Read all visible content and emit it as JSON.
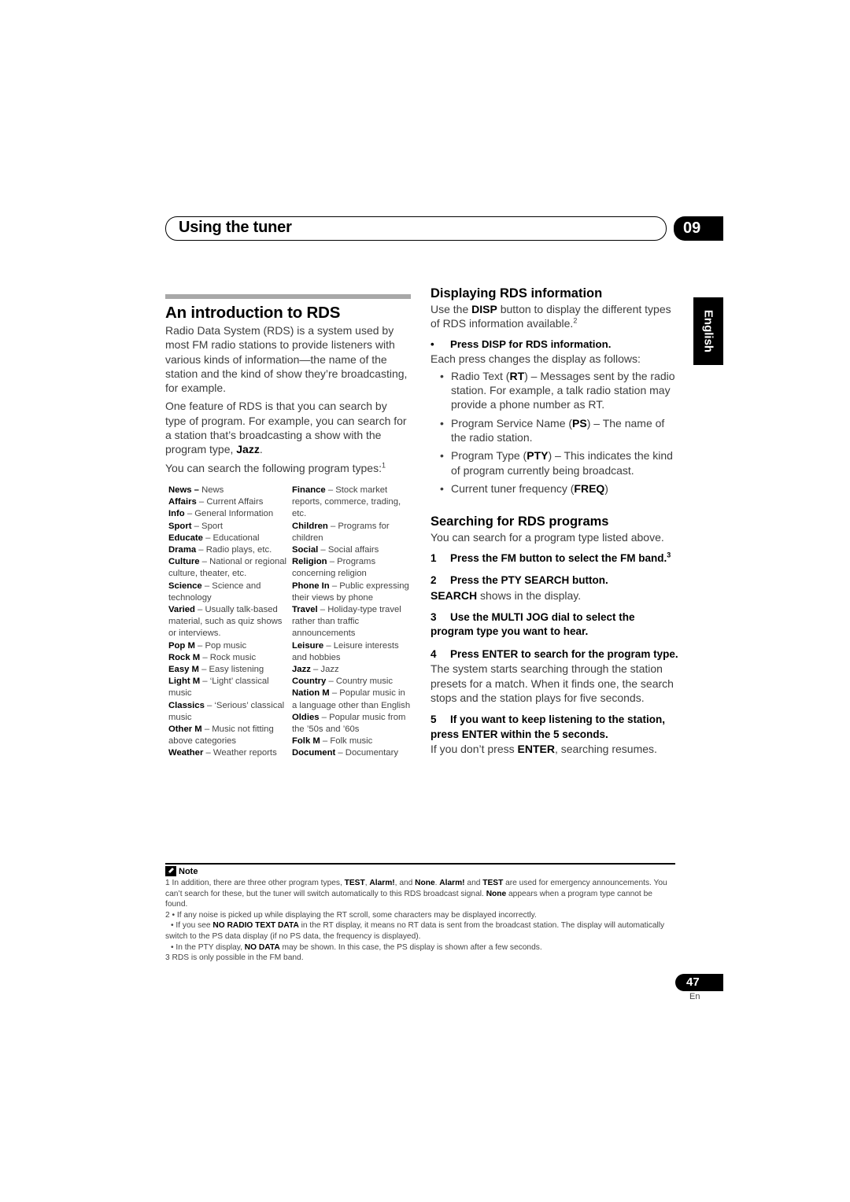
{
  "header": {
    "title": "Using the tuner",
    "chapter": "09"
  },
  "language_tab": "English",
  "intro": {
    "heading": "An introduction to RDS",
    "paragraphs": [
      "Radio Data System (RDS) is a system used by most FM radio stations to provide listeners with various kinds of information—the name of the station and the kind of show they’re broadcasting, for example.",
      "One feature of RDS is that you can search by type of program. For example, you can search for a station that’s broadcasting a show with the program type, "
    ],
    "jazz_bold": "Jazz",
    "period": ".",
    "search_line": "You can search the following program types:",
    "search_footnote": "1"
  },
  "program_types": {
    "left": [
      {
        "name": "News –",
        "desc": " News"
      },
      {
        "name": "Affairs",
        "desc": " – Current Affairs"
      },
      {
        "name": "Info",
        "desc": " – General Information"
      },
      {
        "name": "Sport",
        "desc": " – Sport"
      },
      {
        "name": "Educate",
        "desc": " – Educational"
      },
      {
        "name": "Drama",
        "desc": " – Radio plays, etc."
      },
      {
        "name": "Culture",
        "desc": " – National or regional culture, theater, etc."
      },
      {
        "name": "Science",
        "desc": " – Science and technology"
      },
      {
        "name": "Varied",
        "desc": " – Usually talk-based material, such as quiz shows or interviews."
      },
      {
        "name": "Pop M",
        "desc": " – Pop music"
      },
      {
        "name": "Rock M",
        "desc": " – Rock music"
      },
      {
        "name": "Easy M",
        "desc": " – Easy listening"
      },
      {
        "name": "Light M",
        "desc": " – ‘Light’ classical music"
      },
      {
        "name": "Classics",
        "desc": " – ‘Serious’ classical music"
      },
      {
        "name": "Other M",
        "desc": " – Music not fitting above categories"
      },
      {
        "name": "Weather",
        "desc": " – Weather reports"
      }
    ],
    "right": [
      {
        "name": "Finance",
        "desc": " – Stock market reports, commerce, trading, etc."
      },
      {
        "name": "Children",
        "desc": " – Programs for children"
      },
      {
        "name": "Social",
        "desc": " – Social affairs"
      },
      {
        "name": "Religion",
        "desc": " – Programs concerning religion"
      },
      {
        "name": "Phone In",
        "desc": " – Public expressing their views by phone"
      },
      {
        "name": "Travel",
        "desc": " – Holiday-type travel rather than traffic announcements"
      },
      {
        "name": "Leisure",
        "desc": " – Leisure interests and hobbies"
      },
      {
        "name": "Jazz",
        "desc": " – Jazz"
      },
      {
        "name": "Country",
        "desc": " – Country music"
      },
      {
        "name": "Nation M",
        "desc": " – Popular music in a language other than English"
      },
      {
        "name": "Oldies",
        "desc": " – Popular music from the ’50s and ’60s"
      },
      {
        "name": "Folk M",
        "desc": " – Folk music"
      },
      {
        "name": "Document",
        "desc": " – Documentary"
      }
    ]
  },
  "display": {
    "heading": "Displaying RDS information",
    "intro_a": "Use the ",
    "intro_bold": "DISP",
    "intro_b": " button to display the different types of RDS information available.",
    "intro_footnote": "2",
    "press_bullet": "•",
    "press_step": "Press DISP for RDS information.",
    "each_press": "Each press changes the display as follows:",
    "items": [
      {
        "a": "Radio Text (",
        "bold": "RT",
        "b": ") – Messages sent by the radio station. For example, a talk radio station may provide a phone number as RT."
      },
      {
        "a": "Program Service Name (",
        "bold": "PS",
        "b": ") – The name of the radio station."
      },
      {
        "a": "Program Type (",
        "bold": "PTY",
        "b": ") – This indicates the kind of program currently being broadcast."
      },
      {
        "a": "Current tuner frequency (",
        "bold": "FREQ",
        "b": ")"
      }
    ]
  },
  "searching": {
    "heading": "Searching for RDS programs",
    "intro": "You can search for a program type listed above.",
    "steps": [
      {
        "num": "1",
        "text": "Press the FM button to select the FM band.",
        "footnote": "3"
      },
      {
        "num": "2",
        "text": "Press the PTY SEARCH button."
      },
      {
        "num": "3",
        "text": "Use the MULTI JOG dial to select the program type you want to hear."
      },
      {
        "num": "4",
        "text": "Press ENTER to search for the program type."
      },
      {
        "num": "5",
        "text": "If you want to keep listening to the station, press ENTER within the 5 seconds."
      }
    ],
    "step2_bold": "SEARCH",
    "step2_detail": " shows in the display.",
    "step4_detail": "The system starts searching through the station presets for a match. When it finds one, the search stops and the station plays for five seconds.",
    "step5_a": "If you don’t press ",
    "step5_bold": "ENTER",
    "step5_b": ", searching resumes."
  },
  "notes": {
    "heading": "Note",
    "n1_a": "1 In addition, there are three other program types, ",
    "n1_b1": "TEST",
    "n1_c": ", ",
    "n1_b2": "Alarm!",
    "n1_d": ", and ",
    "n1_b3": "None",
    "n1_e": ". ",
    "n1_b4": "Alarm!",
    "n1_f": " and ",
    "n1_b5": "TEST",
    "n1_g": " are used for emergency announcements. You can’t search for these, but the tuner will switch automatically to this RDS broadcast signal. ",
    "n1_b6": "None",
    "n1_h": " appears when a program type cannot be found.",
    "n2_1": "2 • If any noise is picked up while displaying the RT scroll, some characters may be displayed incorrectly.",
    "n2_2a": "• If you see ",
    "n2_2b": "NO RADIO TEXT DATA",
    "n2_2c": " in the RT display, it means no RT data is sent from the broadcast station. The display will automatically switch to the PS data display (if no PS data, the frequency is displayed).",
    "n2_3a": "• In the PTY display, ",
    "n2_3b": "NO DATA",
    "n2_3c": " may be shown. In this case, the PS display is shown after a few seconds.",
    "n3": "3 RDS is only possible in the FM band."
  },
  "footer": {
    "page_number": "47",
    "page_lang": "En"
  }
}
